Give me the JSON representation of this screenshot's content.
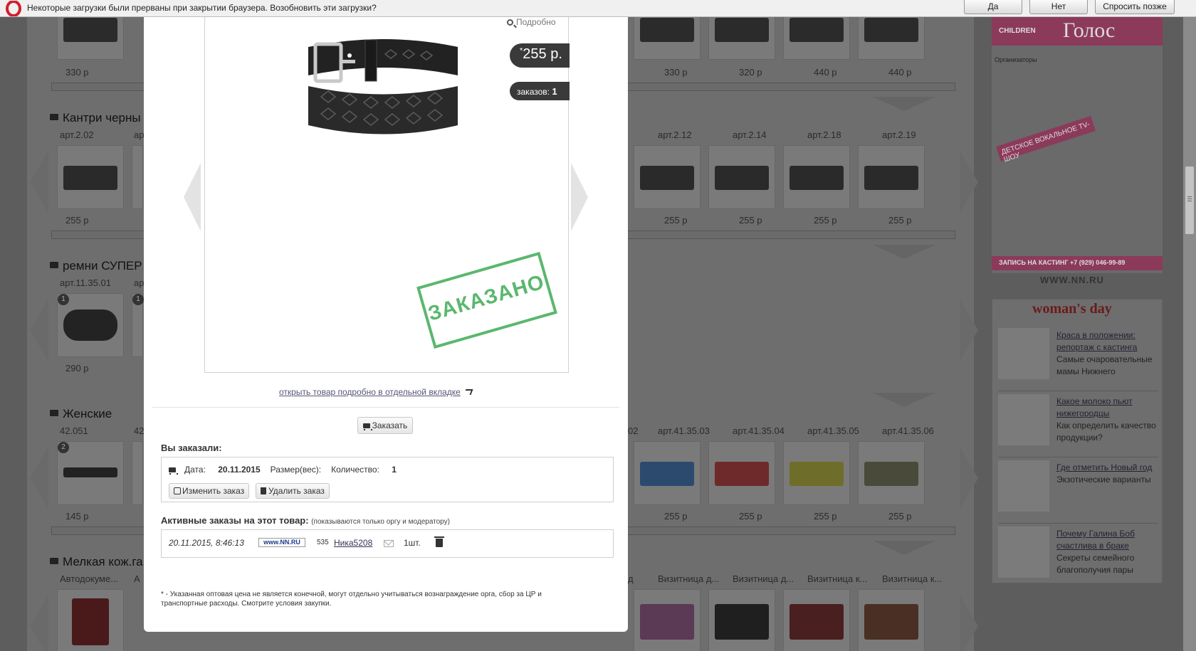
{
  "infobar": {
    "message": "Некоторые загрузки были прерваны при закрытии браузера. Возобновить эти загрузки?",
    "yes": "Да",
    "no": "Нет",
    "ask_later": "Спросить позже"
  },
  "background": {
    "sections": [
      {
        "title": "Кантри черны",
        "skus": [
          "арт.2.02",
          "ар",
          "арт.2.12",
          "арт.2.14",
          "арт.2.18",
          "арт.2.19"
        ],
        "prices": [
          "255 р",
          "255 р",
          "255 р",
          "255 р",
          "255 р"
        ]
      },
      {
        "title": "ремни СУПЕР",
        "skus": [
          "арт.11.35.01",
          "ар"
        ],
        "prices": [
          "290 р"
        ],
        "badges": [
          "1",
          "1"
        ]
      },
      {
        "title": "Женские",
        "skus": [
          "42.051",
          "42",
          "02",
          "арт.41.35.03",
          "арт.41.35.04",
          "арт.41.35.05",
          "арт.41.35.06"
        ],
        "prices": [
          "145 р",
          "255 р",
          "255 р",
          "255 р",
          "255 р"
        ],
        "badges": [
          "2"
        ]
      },
      {
        "title": "Мелкая кож.га",
        "skus": [
          "Автодокуме...",
          "А",
          "д",
          "Визитница д...",
          "Визитница д...",
          "Визитница к...",
          "Визитница к..."
        ]
      }
    ],
    "top_prices": [
      "330 р",
      "330 р",
      "320 р",
      "440 р",
      "440 р"
    ]
  },
  "banner1": {
    "top_left": "CHILDREN",
    "top_right": "Голос",
    "organizers": "Организаторы",
    "ribbon": "ДЕТСКОЕ ВОКАЛЬНОЕ TV-ШОУ",
    "bottom": "ЗАПИСЬ НА КАСТИНГ +7 (929) 046-99-89",
    "nn": "WWW.NN.RU"
  },
  "banner2": {
    "title": "woman's day",
    "items": [
      {
        "link": "Краса в положении: репортаж с кастинга",
        "text": "Самые очаровательные мамы Нижнего"
      },
      {
        "link": "Какое молоко пьют нижегородцы",
        "text": "Как определить качество продукции?"
      },
      {
        "link": "Где отметить Новый год",
        "text": "Экзотические варианты"
      },
      {
        "link": "Почему Галина Боб счастлива в браке",
        "text": "Секреты семейного благополучия пары"
      }
    ]
  },
  "modal": {
    "more_label": "Подробно",
    "price": "255 р.",
    "price_mark": "*",
    "orders_label": "заказов:",
    "orders_count": "1",
    "stamp": "ЗАКАЗАНО",
    "open_link": "открыть товар подробно в отдельной вкладке",
    "order_button": "Заказать",
    "you_ordered_title": "Вы заказали:",
    "order": {
      "date_label": "Дата:",
      "date": "20.11.2015",
      "size_label": "Размер(вес):",
      "qty_label": "Количество:",
      "qty": "1"
    },
    "edit_button": "Изменить заказ",
    "delete_button": "Удалить заказ",
    "active_title": "Активные заказы на этот товар:",
    "active_note": "(показываются только оргу и модератору)",
    "active_order": {
      "datetime": "20.11.2015, 8:46:13",
      "site": "www.NN.RU",
      "rating": "535",
      "user": "Ника5208",
      "qty": "1шт."
    },
    "footnote": "* - Указанная оптовая цена не является конечной, могут отдельно учитываться вознаграждение орга, сбор за ЦР и транспортные расходы. Смотрите условия закупки."
  }
}
